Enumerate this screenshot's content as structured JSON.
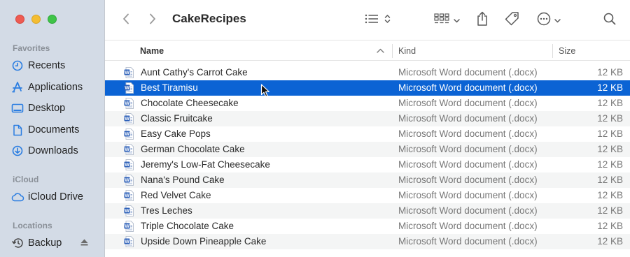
{
  "window": {
    "title": "CakeRecipes"
  },
  "sidebar": {
    "sections": [
      {
        "label": "Favorites",
        "items": [
          {
            "label": "Recents",
            "icon": "clock-icon"
          },
          {
            "label": "Applications",
            "icon": "applications-icon"
          },
          {
            "label": "Desktop",
            "icon": "desktop-icon"
          },
          {
            "label": "Documents",
            "icon": "document-icon"
          },
          {
            "label": "Downloads",
            "icon": "download-icon"
          }
        ]
      },
      {
        "label": "iCloud",
        "items": [
          {
            "label": "iCloud Drive",
            "icon": "cloud-icon"
          }
        ]
      },
      {
        "label": "Locations",
        "items": [
          {
            "label": "Backup",
            "icon": "backup-clock-icon"
          }
        ]
      }
    ]
  },
  "columns": {
    "name": "Name",
    "kind": "Kind",
    "size": "Size"
  },
  "files": [
    {
      "name": "Aunt Cathy's Carrot Cake",
      "kind": "Microsoft Word document (.docx)",
      "size": "12 KB"
    },
    {
      "name": "Best Tiramisu",
      "kind": "Microsoft Word document (.docx)",
      "size": "12 KB",
      "selected": true
    },
    {
      "name": "Chocolate Cheesecake",
      "kind": "Microsoft Word document (.docx)",
      "size": "12 KB"
    },
    {
      "name": "Classic Fruitcake",
      "kind": "Microsoft Word document (.docx)",
      "size": "12 KB"
    },
    {
      "name": "Easy Cake Pops",
      "kind": "Microsoft Word document (.docx)",
      "size": "12 KB"
    },
    {
      "name": "German Chocolate Cake",
      "kind": "Microsoft Word document (.docx)",
      "size": "12 KB"
    },
    {
      "name": "Jeremy's Low-Fat Cheesecake",
      "kind": "Microsoft Word document (.docx)",
      "size": "12 KB"
    },
    {
      "name": "Nana's Pound Cake",
      "kind": "Microsoft Word document (.docx)",
      "size": "12 KB"
    },
    {
      "name": "Red Velvet Cake",
      "kind": "Microsoft Word document (.docx)",
      "size": "12 KB"
    },
    {
      "name": "Tres Leches",
      "kind": "Microsoft Word document (.docx)",
      "size": "12 KB"
    },
    {
      "name": "Triple Chocolate Cake",
      "kind": "Microsoft Word document (.docx)",
      "size": "12 KB"
    },
    {
      "name": "Upside Down Pineapple Cake",
      "kind": "Microsoft Word document (.docx)",
      "size": "12 KB"
    }
  ],
  "colors": {
    "accent": "#0b63d4",
    "sidebar_icon": "#2a7de1",
    "word_icon": "#2b5fb8"
  }
}
